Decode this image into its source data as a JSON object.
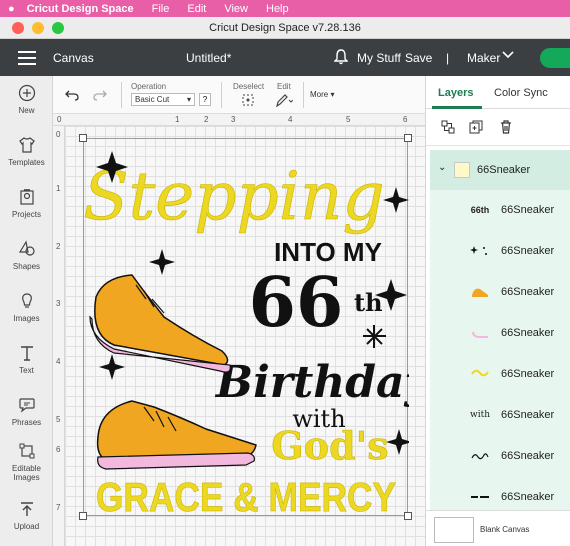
{
  "menubar": {
    "apple": "",
    "app_name": "Cricut Design Space",
    "items": [
      "File",
      "Edit",
      "View",
      "Help"
    ]
  },
  "window": {
    "title": "Cricut Design Space  v7.28.136"
  },
  "topnav": {
    "canvas_label": "Canvas",
    "document_title": "Untitled*",
    "my_stuff": "My Stuff",
    "save": "Save",
    "separator": "|",
    "machine": "Maker"
  },
  "sidebar": {
    "items": [
      {
        "label": "New",
        "icon": "plus-circle-icon"
      },
      {
        "label": "Templates",
        "icon": "shirt-icon"
      },
      {
        "label": "Projects",
        "icon": "projects-icon"
      },
      {
        "label": "Shapes",
        "icon": "shapes-icon"
      },
      {
        "label": "Images",
        "icon": "lightbulb-icon"
      },
      {
        "label": "Text",
        "icon": "text-icon"
      },
      {
        "label": "Phrases",
        "icon": "speech-bubble-icon"
      },
      {
        "label": "Editable\nImages",
        "label_line1": "Editable",
        "label_line2": "Images",
        "icon": "editable-images-icon"
      },
      {
        "label": "Upload",
        "icon": "upload-icon"
      }
    ]
  },
  "toolbar": {
    "operation_label": "Operation",
    "operation_value": "Basic Cut",
    "help": "?",
    "deselect_label": "Deselect",
    "edit_label": "Edit",
    "more_label": "More"
  },
  "rulers": {
    "top": [
      "0",
      "1",
      "2",
      "3",
      "4",
      "5",
      "6"
    ],
    "left": [
      "0",
      "1",
      "2",
      "3",
      "4",
      "5",
      "6",
      "7"
    ]
  },
  "design": {
    "line1": "Stepping",
    "line2": "INTO MY",
    "line3": "66",
    "line3_suffix": "th",
    "line4": "Birthday",
    "line5": "with",
    "line6": "God's",
    "line7": "GRACE & MERCY",
    "colors": {
      "yellow": "#ecd722",
      "black": "#111111",
      "orange": "#f0a621",
      "pink": "#f2b8dd"
    }
  },
  "right_panel": {
    "tabs": [
      "Layers",
      "Color Sync"
    ],
    "group_name": "66Sneaker",
    "layers": [
      {
        "name": "66Sneaker",
        "thumb": "66th"
      },
      {
        "name": "66Sneaker",
        "thumb": ""
      },
      {
        "name": "66Sneaker",
        "thumb": ""
      },
      {
        "name": "66Sneaker",
        "thumb": ""
      },
      {
        "name": "66Sneaker",
        "thumb": ""
      },
      {
        "name": "66Sneaker",
        "thumb": "with"
      },
      {
        "name": "66Sneaker",
        "thumb": ""
      },
      {
        "name": "66Sneaker",
        "thumb": ""
      }
    ],
    "blank_canvas": "Blank Canvas"
  }
}
